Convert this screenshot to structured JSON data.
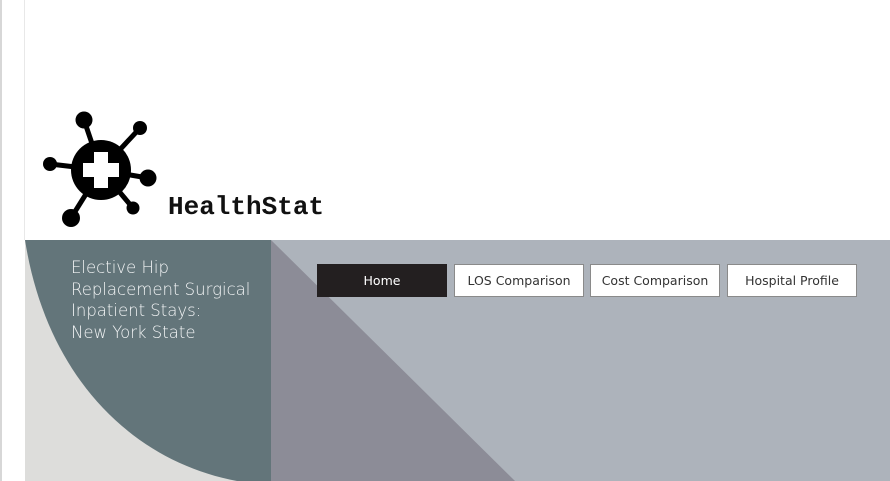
{
  "brand": {
    "name": "HealthStat",
    "logo_icon": "medical-network-icon"
  },
  "banner": {
    "title_lines": [
      "Elective Hip",
      "Replacement Surgical",
      "Inpatient Stays:",
      "New York State"
    ]
  },
  "nav": {
    "items": [
      {
        "label": "Home",
        "active": true
      },
      {
        "label": "LOS Comparison",
        "active": false
      },
      {
        "label": "Cost Comparison",
        "active": false
      },
      {
        "label": "Hospital Profile",
        "active": false
      }
    ]
  },
  "colors": {
    "teal_panel": "#63757a",
    "light_panel": "#dddddb",
    "slate_panel": "#adb3bb",
    "purple_gray_triangle": "#8c8c97",
    "active_button": "#231f20"
  }
}
